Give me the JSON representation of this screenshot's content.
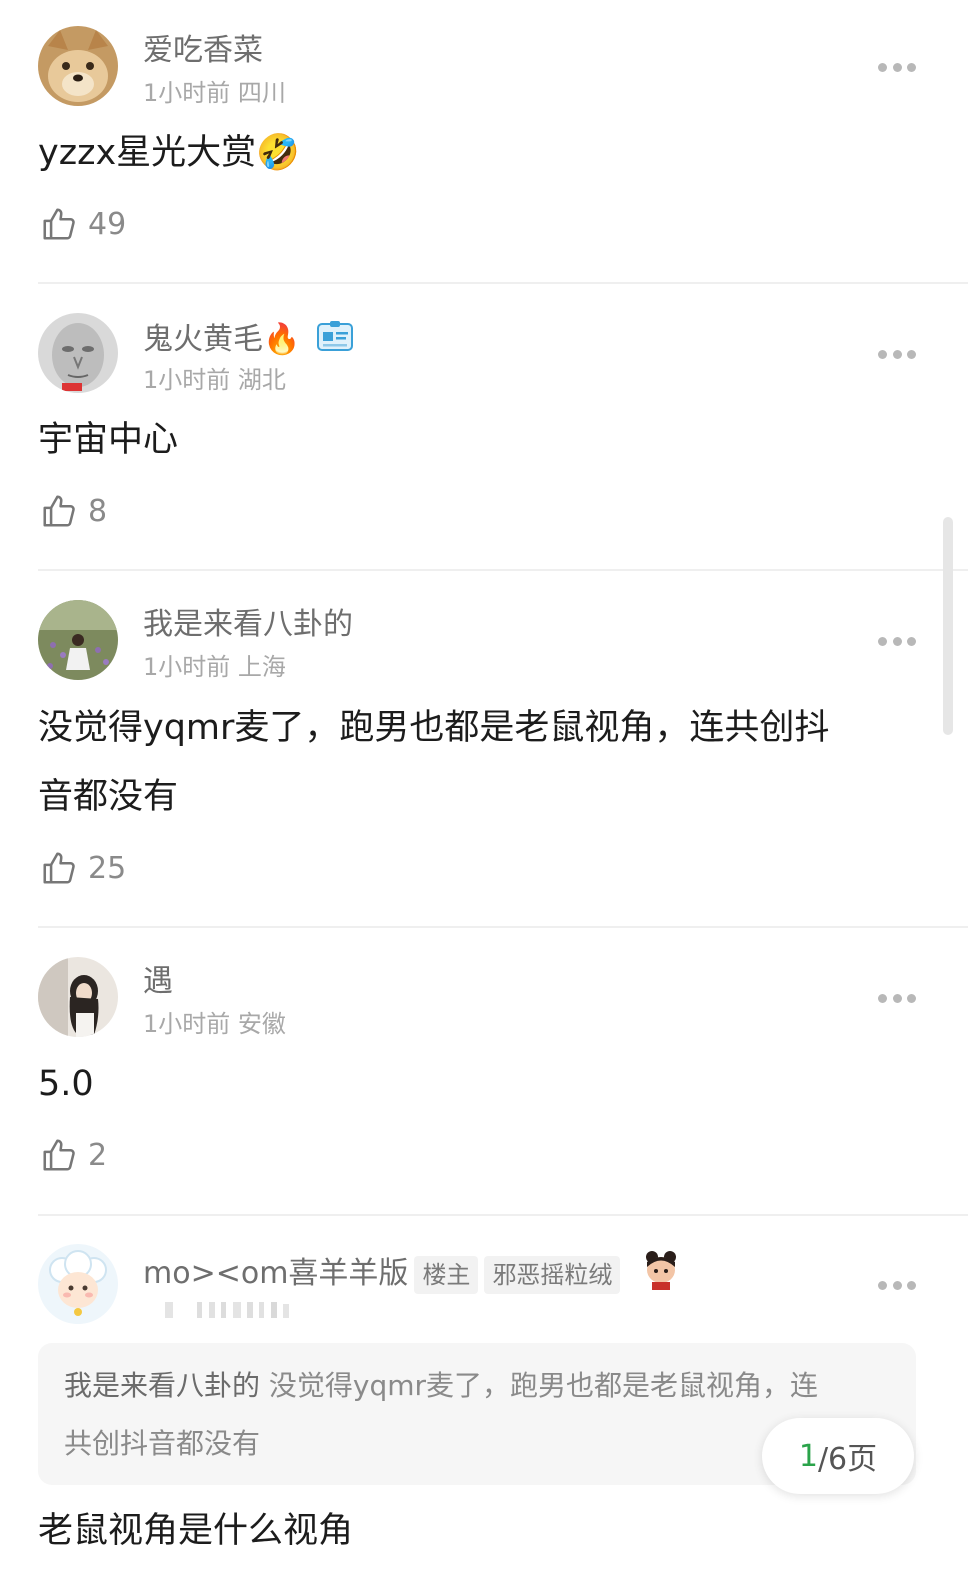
{
  "comments": [
    {
      "username": "爱吃香菜",
      "meta": "1小时前 四川",
      "content": "yzzx星光大赏🤣",
      "likes": "49",
      "avatar_icon": "shiba-dog-avatar"
    },
    {
      "username": "鬼火黄毛🔥",
      "meta": "1小时前 湖北",
      "content": "宇宙中心",
      "likes": "8",
      "avatar_icon": "stone-face-avatar",
      "extra_icon": "id-card-badge-icon"
    },
    {
      "username": "我是来看八卦的",
      "meta": "1小时前 上海",
      "content_lines": [
        "没觉得yqmr麦了，跑男也都是老鼠视角，连共创抖",
        "音都没有"
      ],
      "likes": "25",
      "avatar_icon": "field-photo-avatar"
    },
    {
      "username": "遇",
      "meta": "1小时前 安徽",
      "content": "5.0",
      "likes": "2",
      "avatar_icon": "girl-photo-avatar"
    },
    {
      "username": "mo><om喜羊羊版",
      "badge_op": "楼主",
      "badge_tag": "邪恶摇粒绒",
      "avatar_icon": "cartoon-sheep-avatar",
      "extra_icon": "nezha-sticker-icon",
      "quote_name": "我是来看八卦的",
      "quote_text_line1": "没觉得yqmr麦了，跑男也都是老鼠视角，连",
      "quote_text_line2": "共创抖音都没有",
      "content": "老鼠视角是什么视角"
    }
  ],
  "pager": {
    "current": "1",
    "rest": "/6页"
  },
  "colors": {
    "accent_green": "#2aa34a",
    "text_primary": "#1c1c1c",
    "text_secondary": "#a8a8a8"
  }
}
